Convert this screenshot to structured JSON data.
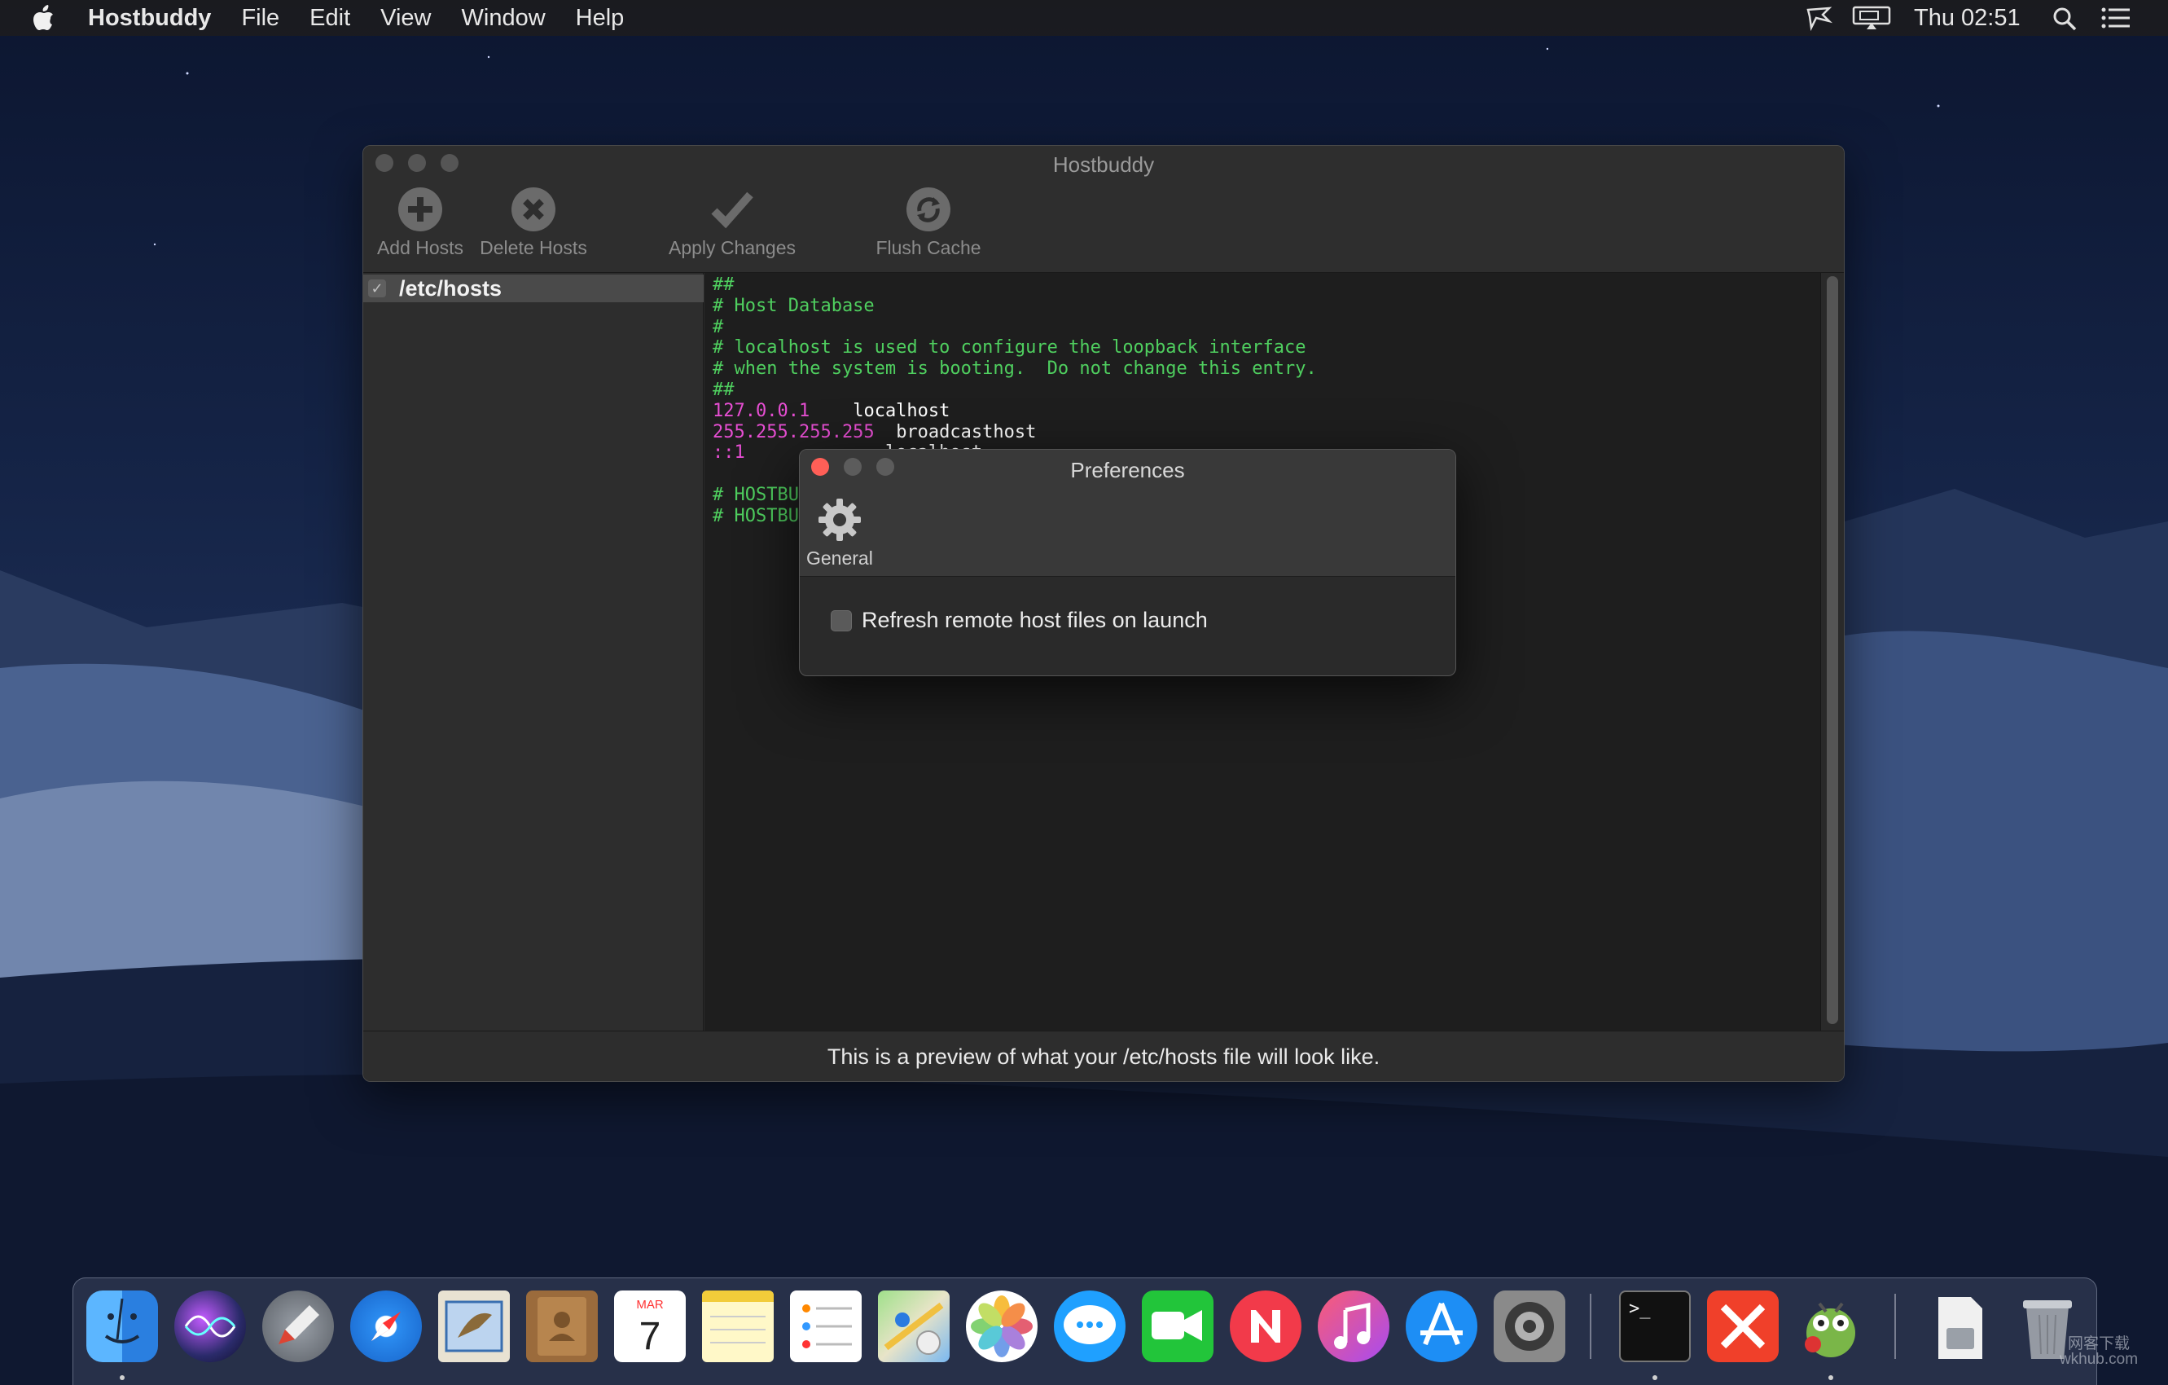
{
  "menubar": {
    "app_name": "Hostbuddy",
    "menus": [
      "File",
      "Edit",
      "View",
      "Window",
      "Help"
    ],
    "clock": "Thu 02:51"
  },
  "main_window": {
    "title": "Hostbuddy",
    "toolbar": {
      "add": "Add Hosts",
      "delete": "Delete Hosts",
      "apply": "Apply Changes",
      "flush": "Flush Cache"
    },
    "sidebar": {
      "items": [
        {
          "label": "/etc/hosts",
          "checked": true
        }
      ]
    },
    "editor_lines": [
      {
        "type": "comment",
        "text": "##"
      },
      {
        "type": "comment",
        "text": "# Host Database"
      },
      {
        "type": "comment",
        "text": "#"
      },
      {
        "type": "comment",
        "text": "# localhost is used to configure the loopback interface"
      },
      {
        "type": "comment",
        "text": "# when the system is booting.  Do not change this entry."
      },
      {
        "type": "comment",
        "text": "##"
      },
      {
        "type": "host",
        "ip": "127.0.0.1",
        "gap": "    ",
        "host": "localhost"
      },
      {
        "type": "host",
        "ip": "255.255.255.255",
        "gap": "  ",
        "host": "broadcasthost"
      },
      {
        "type": "host",
        "ip": "::1",
        "gap": "             ",
        "host": "localhost"
      },
      {
        "type": "blank",
        "text": ""
      },
      {
        "type": "comment",
        "text": "# HOSTBU"
      },
      {
        "type": "comment",
        "text": "# HOSTBU"
      }
    ],
    "status": "This is a preview of what your /etc/hosts file will look like."
  },
  "prefs_window": {
    "title": "Preferences",
    "tab_general": "General",
    "refresh_label": "Refresh remote host files on launch",
    "refresh_checked": false
  },
  "dock": {
    "apps": [
      "finder-icon",
      "siri-icon",
      "launchpad-icon",
      "safari-icon",
      "mail-icon",
      "contacts-icon",
      "calendar-icon",
      "notes-icon",
      "reminders-icon",
      "maps-icon",
      "photos-icon",
      "messages-icon",
      "facetime-icon",
      "news-icon",
      "itunes-icon",
      "app-store-icon",
      "system-preferences-icon",
      "terminal-icon",
      "xmind-icon",
      "hostbuddy-app-icon",
      "downloads-stack-icon",
      "trash-icon"
    ],
    "calendar_month": "MAR",
    "calendar_day": "7",
    "terminal_prompt": ">_"
  },
  "watermark": {
    "line1": "网客下载",
    "line2": "wkhub.com"
  },
  "colors": {
    "comment": "#4fcf5f",
    "ip": "#e64ed2",
    "close_red": "#ff5f57"
  }
}
